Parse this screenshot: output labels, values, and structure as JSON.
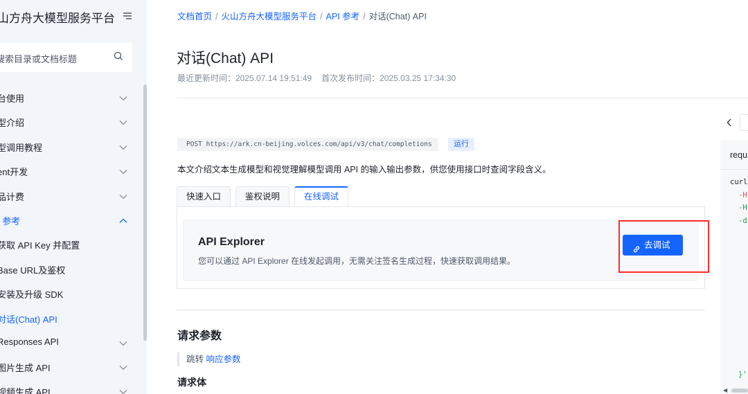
{
  "sidebar": {
    "title": "山方舟大模型服务平台",
    "search_placeholder": "搜索目录或文档标题",
    "items": [
      {
        "label": "台使用"
      },
      {
        "label": "型介绍"
      },
      {
        "label": "型调用教程"
      },
      {
        "label": "ent开发"
      },
      {
        "label": "品计费"
      },
      {
        "label": "I 参考"
      },
      {
        "label": "获取 API Key 并配置"
      },
      {
        "label": "Base URL及鉴权"
      },
      {
        "label": "安装及升级 SDK"
      },
      {
        "label": "对话(Chat) API"
      },
      {
        "label": "Responses API"
      },
      {
        "label": "图片生成 API"
      },
      {
        "label": "视频生成 API"
      }
    ]
  },
  "breadcrumb": {
    "items": [
      "文档首页",
      "火山方舟大模型服务平台",
      "API 参考"
    ],
    "current": "对话(Chat) API",
    "separator": "/"
  },
  "page": {
    "title": "对话(Chat) API",
    "updated": "最近更新时间：2025.07.14 19:51:49",
    "published": "首次发布时间：2025.03.25 17:34:30"
  },
  "endpoint": {
    "text": "POST https://ark.cn-beijing.volces.com/api/v3/chat/completions",
    "run_label": "运行"
  },
  "intro": "本文介绍文本生成模型和视觉理解模型调用 API 的输入输出参数，供您使用接口时查阅字段含义。",
  "tabs": [
    {
      "label": "快速入口"
    },
    {
      "label": "鉴权说明"
    },
    {
      "label": "在线调试"
    }
  ],
  "explorer": {
    "title": "API Explorer",
    "description": "您可以通过 API Explorer 在线发起调用，无需关注签名生成过程，快速获取调用结果。",
    "button_label": "去调试"
  },
  "request_params": {
    "heading": "请求参数",
    "jump_prefix": "跳转",
    "jump_link": "响应参数",
    "body_heading": "请求体"
  },
  "code_panel": {
    "header": "requ",
    "lines": [
      "curl",
      "-H",
      "-H",
      "-d",
      "}'"
    ]
  },
  "colors": {
    "accent": "#1664ff",
    "highlight_box": "#ff2a2a",
    "sidebar_bg": "#f2f5fa"
  }
}
